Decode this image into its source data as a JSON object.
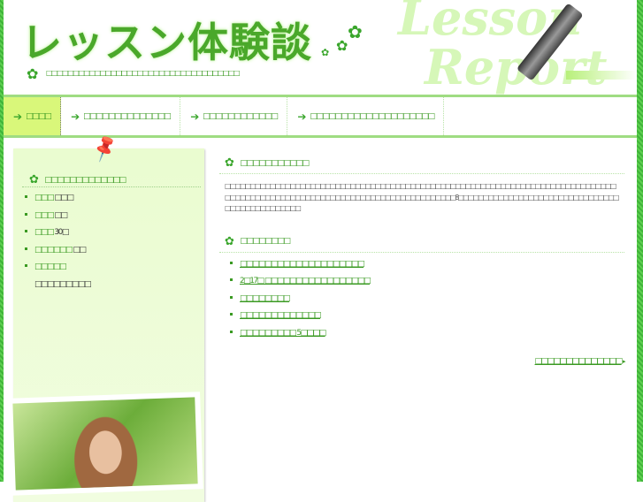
{
  "header": {
    "title": "レッスン体験談",
    "tagline": "□□□□□□□□□□□□□□□□□□□□□□□□□□□□□□□□□□□□",
    "logo_text": [
      "Lesson",
      "Report"
    ]
  },
  "nav": [
    {
      "label": "□□□□"
    },
    {
      "label": "□□□□□□□□□□□□□□"
    },
    {
      "label": "□□□□□□□□□□□□"
    },
    {
      "label": "□□□□□□□□□□□□□□□□□□□□"
    }
  ],
  "sidebar": {
    "heading": "□□□□□□□□□□□□□",
    "items": [
      {
        "key": "□□□",
        "value": "□□□"
      },
      {
        "key": "□□□",
        "value": "□□"
      },
      {
        "key": "□□□",
        "value": "30□"
      },
      {
        "key": "□□□□□□",
        "value": "□□"
      },
      {
        "key": "□□□□□",
        "value": ""
      }
    ],
    "sub_text": "□□□□□□□□□"
  },
  "main": {
    "section1_heading": "□□□□□□□□□□□",
    "paragraph": "□□□□□□□□□□□□□□□□□□□□□□□□□□□□□□□□□□□□□□□□□□□□□□□□□□□□□□□□□□□□□□□□□□□□□□□□□□□□□□□□□□□□□□□□□□□□□□□□□□□□□□□□□□□□□□□□□□□□□□□□□□□□8□□□□□□□□□□□□□□□□□□□□□□□□□□□□□□□□□□□□□□□□□□□□□□□",
    "section2_heading": "□□□□□□□□",
    "links": [
      "□□□□□□□□□□□□□□□□□□□□",
      "2□17□ □□□□□□□□□□□□□□□□□",
      "□□□□□□□□",
      "□□□□□□□□□□□□□",
      "□□□□□□□□□ 5□□□□"
    ],
    "more_link": "□□□□□□□□□□□□□□"
  }
}
